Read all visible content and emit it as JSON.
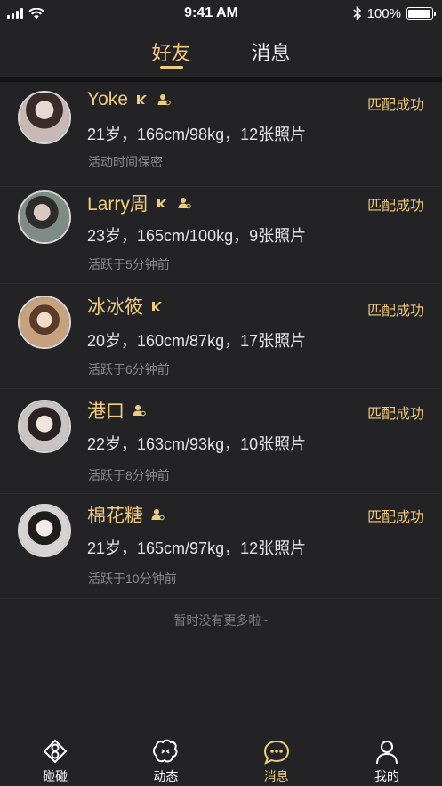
{
  "status_bar": {
    "time": "9:41 AM",
    "battery": "100%"
  },
  "tabs": [
    {
      "label": "好友",
      "active": true
    },
    {
      "label": "消息",
      "active": false
    }
  ],
  "friends": [
    {
      "name": "Yoke",
      "vip": true,
      "verified": true,
      "info": "21岁，166cm/98kg，12张照片",
      "active": "活动时间保密",
      "status": "匹配成功",
      "avatar_color": "#c9b9b6"
    },
    {
      "name": "Larry周",
      "vip": true,
      "verified": true,
      "info": "23岁，165cm/100kg，9张照片",
      "active": "活跃于5分钟前",
      "status": "匹配成功",
      "avatar_color": "#7f8c86"
    },
    {
      "name": "冰冰筱",
      "vip": true,
      "verified": false,
      "info": "20岁，160cm/87kg，17张照片",
      "active": "活跃于6分钟前",
      "status": "匹配成功",
      "avatar_color": "#c7a27f"
    },
    {
      "name": "港口",
      "vip": false,
      "verified": true,
      "info": "22岁，163cm/93kg，10张照片",
      "active": "活跃于8分钟前",
      "status": "匹配成功",
      "avatar_color": "#c9c4c3"
    },
    {
      "name": "棉花糖",
      "vip": false,
      "verified": true,
      "info": "21岁，165cm/97kg，12张照片",
      "active": "活跃于10分钟前",
      "status": "匹配成功",
      "avatar_color": "#d8d3d3"
    }
  ],
  "footer_text": "暂时没有更多啦~",
  "bottom_nav": [
    {
      "label": "碰碰",
      "icon": "bump-icon",
      "active": false
    },
    {
      "label": "动态",
      "icon": "moments-icon",
      "active": false
    },
    {
      "label": "消息",
      "icon": "message-icon",
      "active": true
    },
    {
      "label": "我的",
      "icon": "profile-icon",
      "active": false
    }
  ],
  "colors": {
    "accent": "#f0cc7e",
    "background": "#232325"
  }
}
